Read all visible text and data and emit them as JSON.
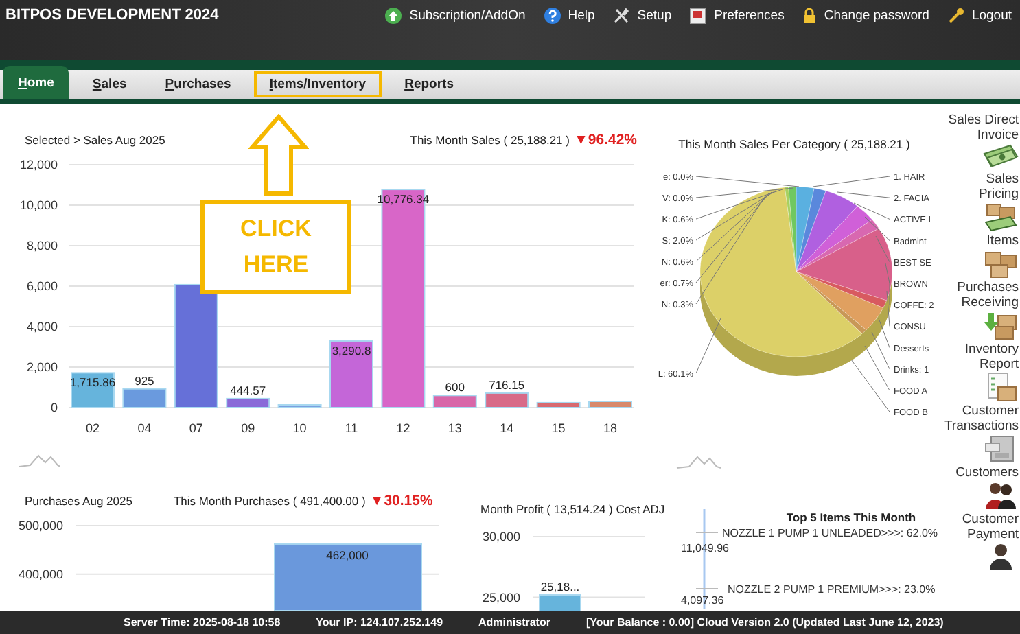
{
  "app": {
    "title": "BITPOS DEVELOPMENT 2024"
  },
  "top_links": [
    {
      "label": "Subscription/AddOn"
    },
    {
      "label": "Help"
    },
    {
      "label": "Setup"
    },
    {
      "label": "Preferences"
    },
    {
      "label": "Change password"
    },
    {
      "label": "Logout"
    }
  ],
  "tabs": [
    {
      "label": "Home",
      "selected": true,
      "highlighted": false
    },
    {
      "label": "Sales",
      "selected": false,
      "highlighted": false
    },
    {
      "label": "Purchases",
      "selected": false,
      "highlighted": false
    },
    {
      "label": "Items/Inventory",
      "selected": false,
      "highlighted": true
    },
    {
      "label": "Reports",
      "selected": false,
      "highlighted": false
    }
  ],
  "callout": {
    "text": "CLICK HERE"
  },
  "sales_panel": {
    "breadcrumb": "Selected > Sales Aug 2025",
    "summary": "This Month Sales ( 25,188.21 )",
    "change": "▼96.42%",
    "chart_data": {
      "type": "bar",
      "categories": [
        "02",
        "04",
        "07",
        "09",
        "10",
        "11",
        "12",
        "13",
        "14",
        "15",
        "18"
      ],
      "values": [
        1715.86,
        925,
        6070,
        444.57,
        60,
        3290.8,
        10776.34,
        600,
        716.15,
        240,
        305
      ],
      "ylim": [
        0,
        12000
      ],
      "grid": true,
      "yticks": [
        {
          "value": 0,
          "label": "0"
        },
        {
          "value": 2000,
          "label": "2,000"
        },
        {
          "value": 4000,
          "label": "4,000"
        },
        {
          "value": 6000,
          "label": "6,000"
        },
        {
          "value": 8000,
          "label": "8,000"
        },
        {
          "value": 10000,
          "label": "10,000"
        },
        {
          "value": 12000,
          "label": "12,000"
        }
      ],
      "value_labels": [
        "1,715.86",
        "925",
        null,
        "444.57",
        null,
        "3,290.8",
        "10,776.34",
        "600",
        "716.15",
        null,
        null
      ]
    }
  },
  "category_panel": {
    "title": "This Month Sales Per Category ( 25,188.21 )",
    "labels_left": [
      "e: 0.0%",
      "V: 0.0%",
      "K: 0.6%",
      "S: 2.0%",
      "N: 0.6%",
      "er: 0.7%",
      "N: 0.3%",
      "L: 60.1%"
    ],
    "labels_right": [
      "1. HAIR",
      "2. FACIA",
      "ACTIVE I",
      "Badmint",
      "BEST SE",
      "BROWN",
      "COFFE: 2",
      "CONSU",
      "Desserts",
      "Drinks: 1",
      "FOOD A",
      "FOOD B"
    ]
  },
  "purchases_panel": {
    "title": "Purchases Aug 2025",
    "summary": "This Month Purchases ( 491,400.00 )",
    "change": "▼30.15%",
    "chart_data": {
      "type": "bar",
      "values": [
        462000
      ],
      "ylim": [
        325000,
        500000
      ],
      "grid": true,
      "yticks": [
        {
          "value": 400000,
          "label": "400,000"
        },
        {
          "value": 500000,
          "label": "500,000"
        }
      ],
      "value_labels": [
        "462,000"
      ]
    }
  },
  "profit_panel": {
    "title": "Month Profit ( 13,514.24 ) Cost ADJ",
    "chart_data": {
      "type": "bar",
      "values": [
        25200
      ],
      "ylim": [
        23000,
        30000
      ],
      "grid": true,
      "yticks": [
        {
          "value": 25000,
          "label": "25,000"
        },
        {
          "value": 30000,
          "label": "30,000"
        }
      ],
      "value_labels": [
        "25,18..."
      ]
    }
  },
  "top_items": {
    "title": "Top 5 Items This Month",
    "items": [
      {
        "label": "NOZZLE 1 PUMP 1 UNLEADED>>>: 62.0%",
        "value": "11,049.96"
      },
      {
        "label": "NOZZLE 2 PUMP 1 PREMIUM>>>: 23.0%",
        "value": "4,097.36"
      }
    ]
  },
  "sidebar": {
    "items": [
      {
        "label": "Sales Direct Invoice"
      },
      {
        "label": "Sales Pricing"
      },
      {
        "label": "Items"
      },
      {
        "label": "Purchases Receiving"
      },
      {
        "label": "Inventory Report"
      },
      {
        "label": "Customer Transactions"
      },
      {
        "label": "Customers"
      },
      {
        "label": "Customer Payment"
      }
    ]
  },
  "status_bar": {
    "server_time": "Server Time: 2025-08-18 10:58",
    "ip": "Your IP: 124.107.252.149",
    "user": "Administrator",
    "version": "[Your Balance : 0.00] Cloud Version 2.0 (Updated Last June 12, 2023)"
  }
}
